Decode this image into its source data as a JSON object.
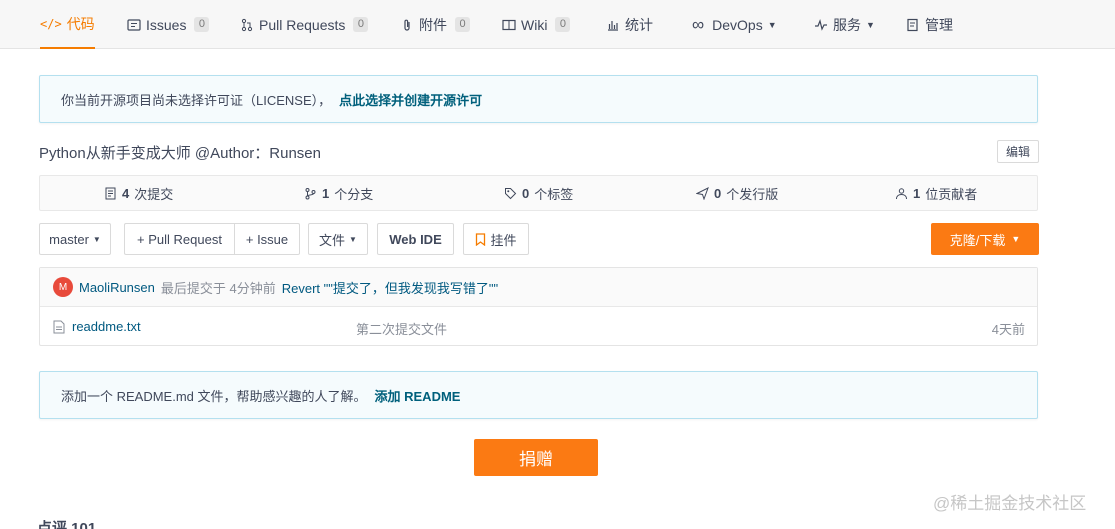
{
  "nav": {
    "code": "代码",
    "issues": "Issues",
    "issues_count": "0",
    "pull_requests": "Pull Requests",
    "pull_requests_count": "0",
    "attachments": "附件",
    "attachments_count": "0",
    "wiki": "Wiki",
    "wiki_count": "0",
    "stats": "统计",
    "devops": "DevOps",
    "services": "服务",
    "manage": "管理"
  },
  "license_banner": {
    "text": "你当前开源项目尚未选择许可证（LICENSE），",
    "link": "点此选择并创建开源许可"
  },
  "repo": {
    "description": "Python从新手变成大师 @Author：Runsen",
    "edit": "编辑"
  },
  "stats": {
    "commits_num": "4",
    "commits_label": "次提交",
    "branches_num": "1",
    "branches_label": "个分支",
    "tags_num": "0",
    "tags_label": "个标签",
    "releases_num": "0",
    "releases_label": "个发行版",
    "contributors_num": "1",
    "contributors_label": "位贡献者"
  },
  "toolbar": {
    "branch": "master",
    "pull_request": "+ Pull Request",
    "issue": "+ Issue",
    "files": "文件",
    "web_ide": "Web IDE",
    "pendant": "挂件",
    "clone": "克隆/下载"
  },
  "commit": {
    "avatar_letter": "M",
    "author": "MaoliRunsen",
    "meta": "最后提交于 4分钟前",
    "message": "Revert \"\"提交了，但我发现我写错了\"\""
  },
  "files": [
    {
      "name": "readdme.txt",
      "message": "第二次提交文件",
      "time": "4天前"
    }
  ],
  "readme_banner": {
    "text": "添加一个 README.md 文件，帮助感兴趣的人了解。",
    "link": "添加 README"
  },
  "donate": "捐赠",
  "watermark": "@稀土掘金技术社区",
  "cutoff_heading": "点评 101"
}
